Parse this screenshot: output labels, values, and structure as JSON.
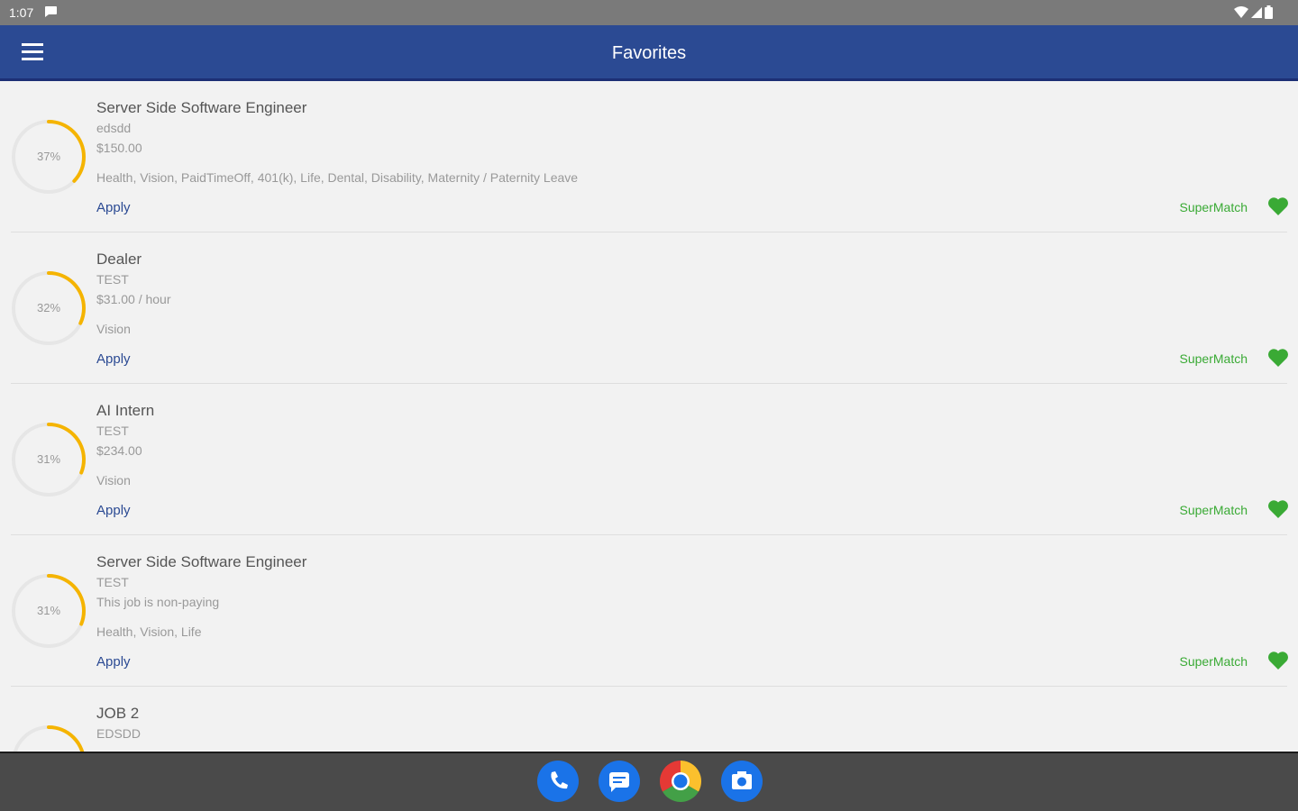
{
  "status_bar": {
    "time": "1:07"
  },
  "app_bar": {
    "title": "Favorites"
  },
  "jobs": [
    {
      "title": "Server Side Software Engineer",
      "company": "edsdd",
      "salary": "$150.00",
      "benefits": "Health, Vision, PaidTimeOff, 401(k), Life, Dental, Disability, Maternity / Paternity Leave",
      "match_label": "37%",
      "match_fraction": 0.37,
      "apply": "Apply",
      "supermatch": "SuperMatch"
    },
    {
      "title": "Dealer",
      "company": "TEST",
      "salary": "$31.00 / hour",
      "benefits": "Vision",
      "match_label": "32%",
      "match_fraction": 0.32,
      "apply": "Apply",
      "supermatch": "SuperMatch"
    },
    {
      "title": "AI Intern",
      "company": "TEST",
      "salary": "$234.00",
      "benefits": "Vision",
      "match_label": "31%",
      "match_fraction": 0.31,
      "apply": "Apply",
      "supermatch": "SuperMatch"
    },
    {
      "title": "Server Side Software Engineer",
      "company": "TEST",
      "salary": "This job is non-paying",
      "benefits": "Health, Vision, Life",
      "match_label": "31%",
      "match_fraction": 0.31,
      "apply": "Apply",
      "supermatch": "SuperMatch"
    },
    {
      "title": "JOB 2",
      "company": "EDSDD",
      "salary": "",
      "benefits": "",
      "match_label": "",
      "match_fraction": 0.3,
      "apply": "",
      "supermatch": ""
    }
  ],
  "colors": {
    "primary": "#2b4a93",
    "ring_accent": "#f5b400",
    "ring_track": "#e6e6e6",
    "supermatch": "#3aaa35"
  },
  "dock": {
    "icons": [
      "phone-icon",
      "messages-icon",
      "chrome-icon",
      "camera-icon"
    ]
  }
}
